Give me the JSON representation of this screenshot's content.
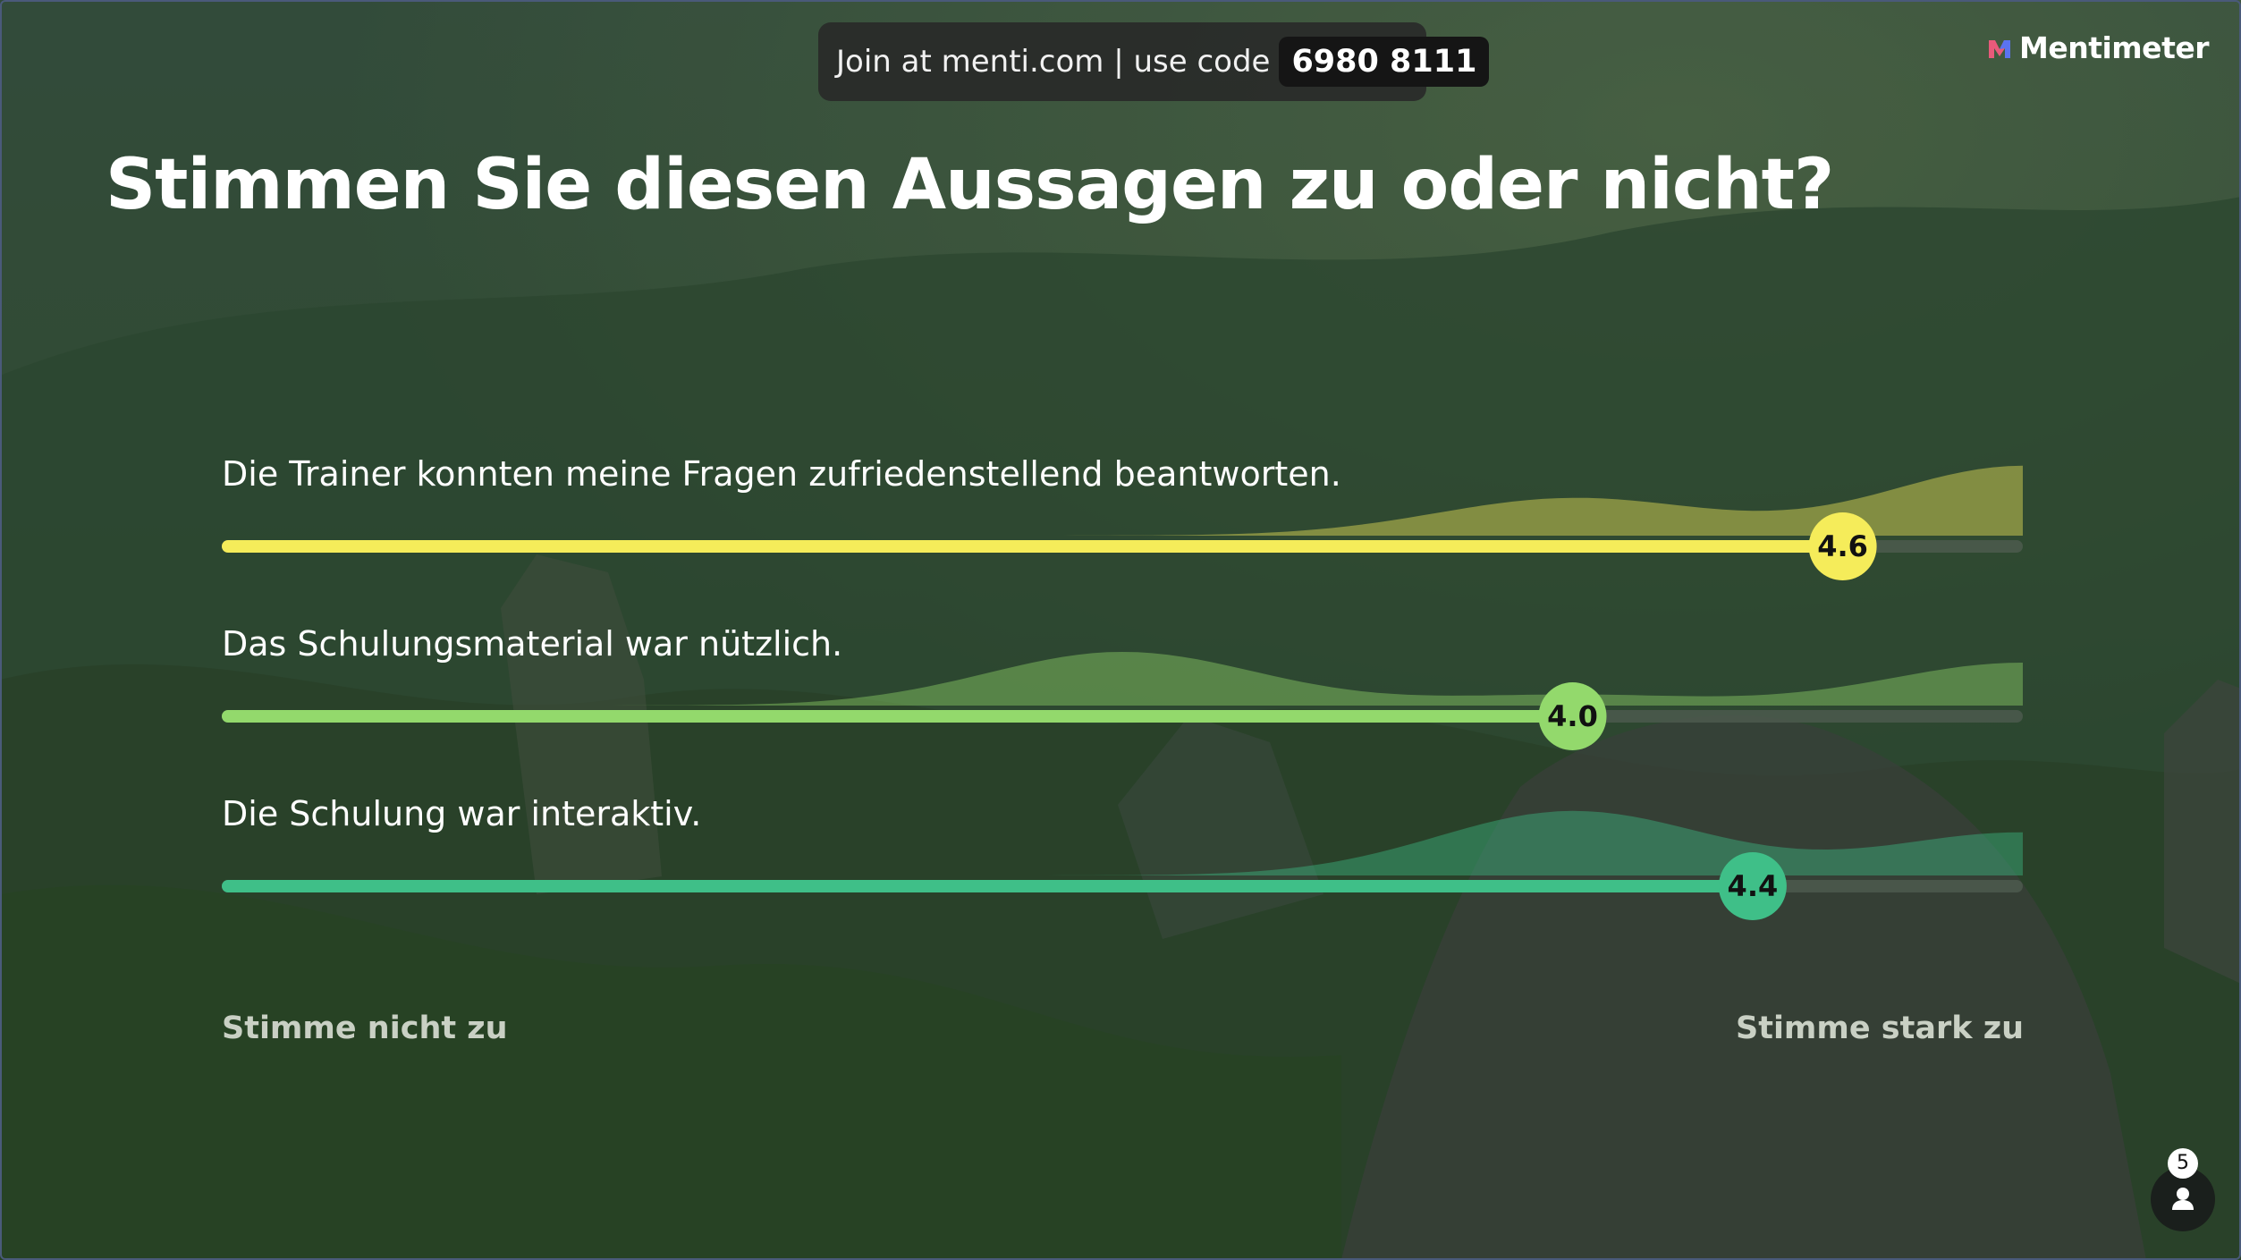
{
  "join_prefix": "Join at menti.com | use code",
  "join_code": "6980 8111",
  "brand": "Mentimeter",
  "title": "Stimmen Sie diesen Aussagen zu oder nicht?",
  "scale": {
    "min_label": "Stimme nicht zu",
    "max_label": "Stimme stark zu"
  },
  "participants": {
    "count": "5",
    "icon": "person-icon"
  },
  "colors": {
    "background": "#2f4a33",
    "statement_1": "#f5ec5a",
    "statement_2": "#93d96c",
    "statement_3": "#3fbf88",
    "track": "#4c5a4e"
  },
  "chart_data": {
    "type": "scale",
    "scale_min": 1,
    "scale_max": 5,
    "statements": [
      {
        "label": "Die Trainer konnten meine Fragen zufriedenstellend beantworten.",
        "average": 4.6,
        "value_label": "4.6",
        "distribution": [
          0,
          0,
          0,
          0.35,
          0.65
        ]
      },
      {
        "label": "Das Schulungsmaterial war nützlich.",
        "average": 4.0,
        "value_label": "4.0",
        "distribution": [
          0,
          0,
          0.5,
          0.1,
          0.4
        ]
      },
      {
        "label": "Die Schulung war interaktiv.",
        "average": 4.4,
        "value_label": "4.4",
        "distribution": [
          0,
          0,
          0,
          0.6,
          0.4
        ]
      }
    ]
  }
}
